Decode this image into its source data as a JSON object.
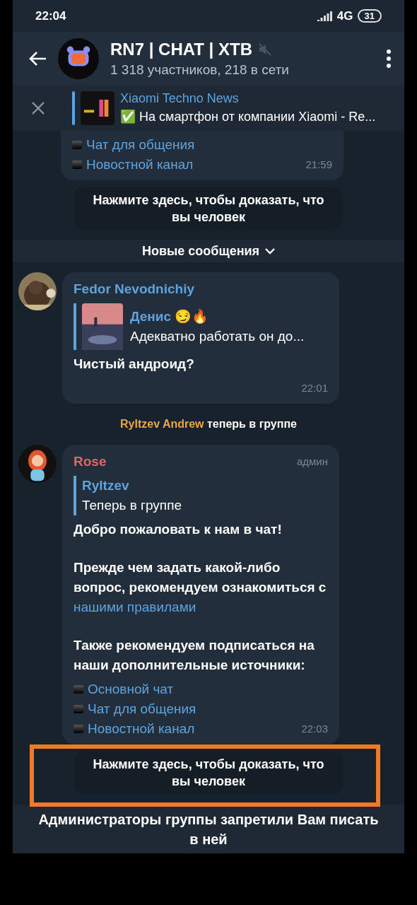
{
  "status_bar": {
    "time": "22:04",
    "network": "4G",
    "battery": "31"
  },
  "header": {
    "title": "RN7 | CHAT | XTB",
    "muted": true,
    "subtitle": "1 318 участников, 218 в сети"
  },
  "pinned": {
    "title": "Xiaomi Techno News",
    "text": "✅ На смартфон от компании Xiaomi - Re..."
  },
  "messages": [
    {
      "kind": "message",
      "cut": true,
      "links": [
        "Чат для общения",
        "Новостной канал"
      ],
      "time": "21:59"
    },
    {
      "kind": "button",
      "label": "Нажмите здесь, чтобы доказать, что вы человек",
      "highlighted": false
    },
    {
      "kind": "divider",
      "label": "Новые сообщения"
    },
    {
      "kind": "message",
      "sender": "Fedor Nevodnichiy",
      "color": "#5fa3de",
      "avatar": {
        "kind": "picture"
      },
      "reply": {
        "sender": "Денис 😏🔥",
        "text": "Адекватно работать он до...",
        "thumb": true
      },
      "paragraphs": [
        {
          "text": "Чистый андроид?"
        }
      ],
      "time": "22:01"
    },
    {
      "kind": "service",
      "name": "Ryltzev Andrew",
      "text": " теперь в группе"
    },
    {
      "kind": "message",
      "sender": "Rose",
      "color": "#e0666a",
      "avatar": {
        "kind": "picture"
      },
      "badge": "админ",
      "reply": {
        "sender": "Ryltzev",
        "text": "Теперь в группе",
        "thumb": false
      },
      "paragraphs": [
        {
          "text": "Добро пожаловать к нам в чат!"
        },
        {
          "text": "Прежде чем задать какой-либо вопрос, рекомендуем ознакомиться с ",
          "link": "нашими правилами"
        },
        {
          "text": "Также рекомендуем подписаться на наши дополнительные источники:"
        }
      ],
      "links": [
        "Основной чат",
        "Чат для общения",
        "Новостной канал"
      ],
      "time": "22:03"
    },
    {
      "kind": "button",
      "label": "Нажмите здесь, чтобы доказать, что вы человек",
      "highlighted": true
    }
  ],
  "footer": {
    "text": "Администраторы группы запретили Вам писать в ней"
  }
}
